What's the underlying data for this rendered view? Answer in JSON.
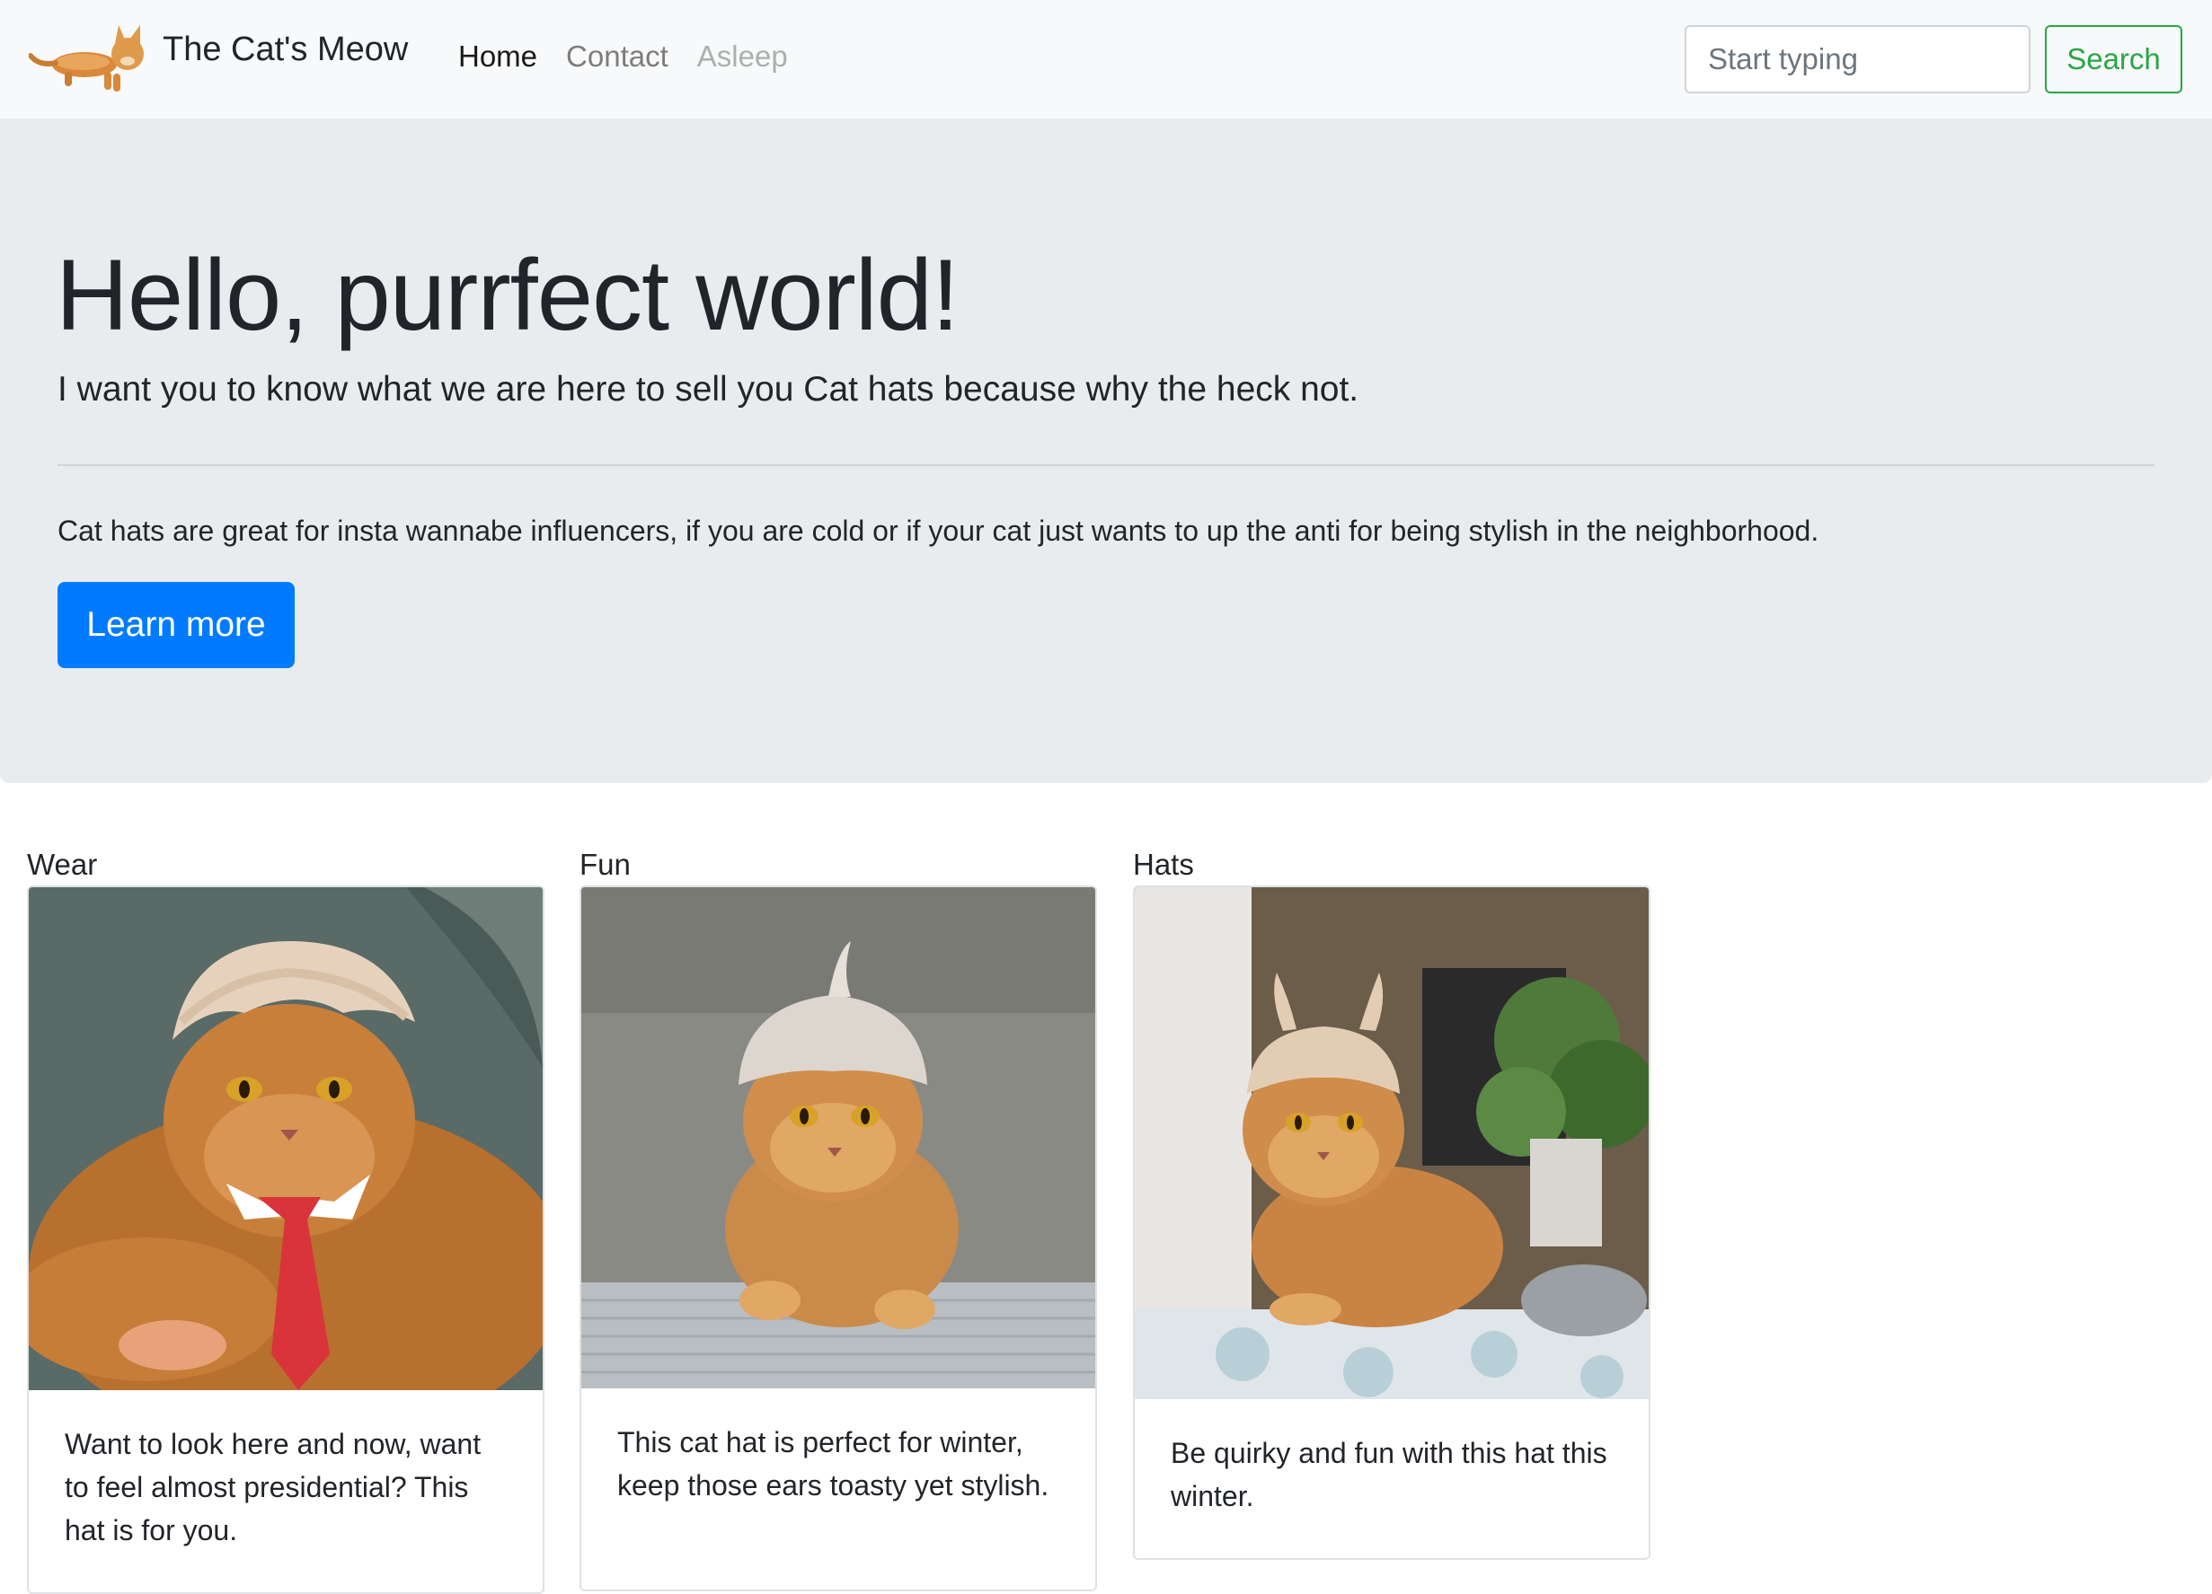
{
  "navbar": {
    "brand": "The Cat's Meow",
    "links": [
      {
        "label": "Home",
        "state": "active"
      },
      {
        "label": "Contact",
        "state": "normal"
      },
      {
        "label": "Asleep",
        "state": "disabled"
      }
    ],
    "search": {
      "placeholder": "Start typing",
      "value": "",
      "button_label": "Search"
    }
  },
  "jumbotron": {
    "title": "Hello, purrfect world!",
    "lead": "I want you to know what we are here to sell you Cat hats because why the heck not.",
    "body": "Cat hats are great for insta wannabe influencers, if you are cold or if your cat just wants to up the anti for being stylish in the neighborhood.",
    "button_label": "Learn more"
  },
  "cards": [
    {
      "label": "Wear",
      "text": "Want to look here and now, want to feel almost presidential? This hat is for you."
    },
    {
      "label": "Fun",
      "text": "This cat hat is perfect for winter, keep those ears toasty yet stylish."
    },
    {
      "label": "Hats",
      "text": "Be quirky and fun with this hat this winter."
    }
  ],
  "colors": {
    "navbar_bg": "#f8f9fa",
    "jumbotron_bg": "#e9ecef",
    "primary": "#007bff",
    "success": "#28a745"
  }
}
